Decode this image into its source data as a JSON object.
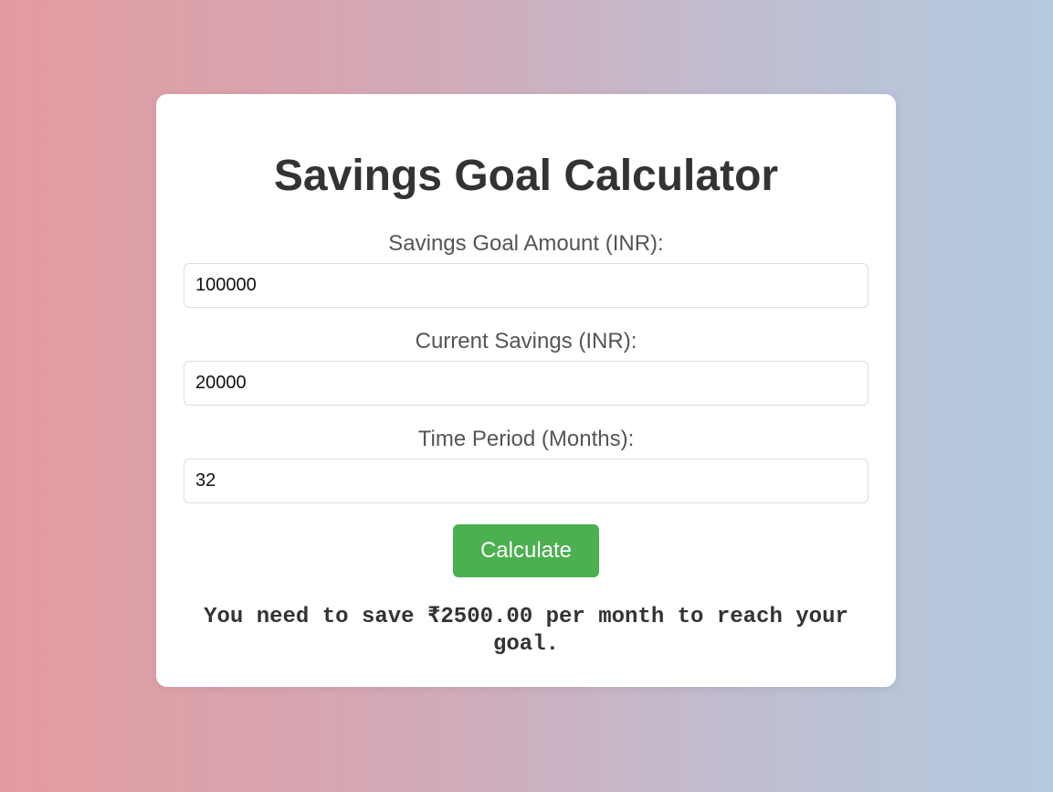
{
  "calculator": {
    "title": "Savings Goal Calculator",
    "fields": [
      {
        "label": "Savings Goal Amount (INR):",
        "value": "100000"
      },
      {
        "label": "Current Savings (INR):",
        "value": "20000"
      },
      {
        "label": "Time Period (Months):",
        "value": "32"
      }
    ],
    "button_label": "Calculate",
    "result": "You need to save ₹2500.00 per month to reach your goal."
  },
  "colors": {
    "button_bg": "#4caf50",
    "title_text": "#333333",
    "label_text": "#555555",
    "gradient_left": "#e49b9f",
    "gradient_right": "#b3cadf"
  }
}
